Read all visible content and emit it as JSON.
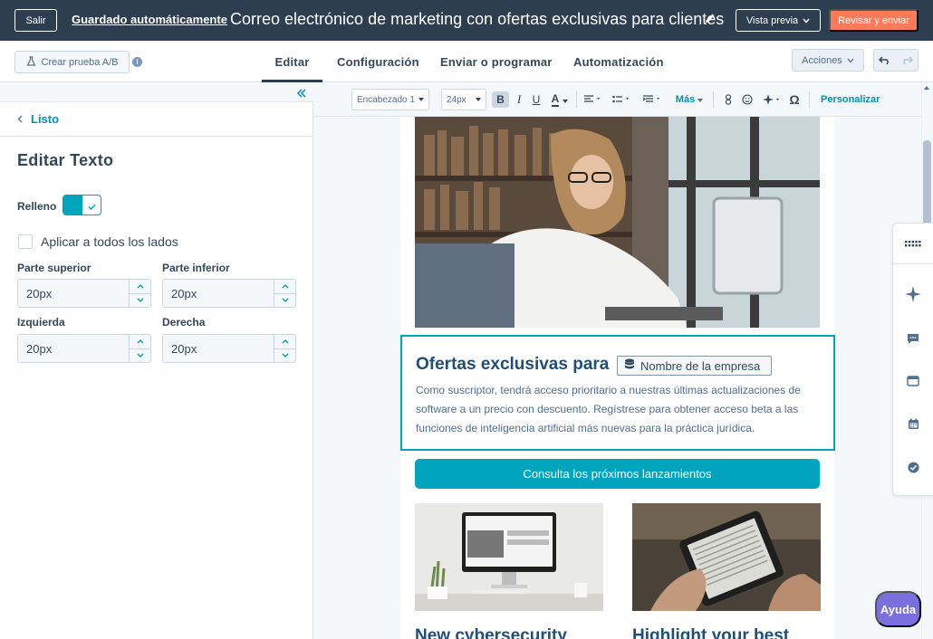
{
  "topbar": {
    "exit_label": "Salir",
    "autosave_label": "Guardado automáticamente",
    "email_title": "Correo electrónico de marketing con ofertas exclusivas para clientes",
    "preview_label": "Vista previa",
    "review_label": "Revisar y enviar"
  },
  "subbar": {
    "ab_label": "Crear prueba A/B",
    "tabs": [
      {
        "label": "Editar"
      },
      {
        "label": "Configuración"
      },
      {
        "label": "Enviar o programar"
      },
      {
        "label": "Automatización"
      }
    ],
    "actions_label": "Acciones"
  },
  "panel": {
    "back_label": "Listo",
    "title": "Editar Texto",
    "relleno_label": "Relleno",
    "apply_all_label": "Aplicar a todos los lados",
    "fields": {
      "top": {
        "label": "Parte superior",
        "value": "20px"
      },
      "bottom": {
        "label": "Parte inferior",
        "value": "20px"
      },
      "left": {
        "label": "Izquierda",
        "value": "20px"
      },
      "right": {
        "label": "Derecha",
        "value": "20px"
      }
    }
  },
  "toolbar": {
    "style_value": "Encabezado 1",
    "size_value": "24px",
    "bold": "B",
    "italic": "I",
    "underline": "U",
    "color": "A",
    "more_label": "Más",
    "omega": "Ω",
    "personalize_label": "Personalizar"
  },
  "email": {
    "heading": "Ofertas exclusivas para",
    "token_label": "Nombre de la empresa",
    "body": "Como suscriptor, tendrá acceso prioritario a nuestras últimas actualizaciones de software a un precio con descuento. Regístrese para obtener acceso beta a las funciones de inteligencia artificial más nuevas para la práctica jurídica.",
    "cta_label": "Consulta los próximos lanzamientos",
    "card1_title": "New cybersecurity",
    "card2_title": "Highlight your best"
  },
  "help_label": "Ayuda",
  "colors": {
    "topbar": "#2d3e50",
    "accent": "#00a4bd",
    "review": "#ff7a59",
    "help": "#7b6fe0"
  }
}
